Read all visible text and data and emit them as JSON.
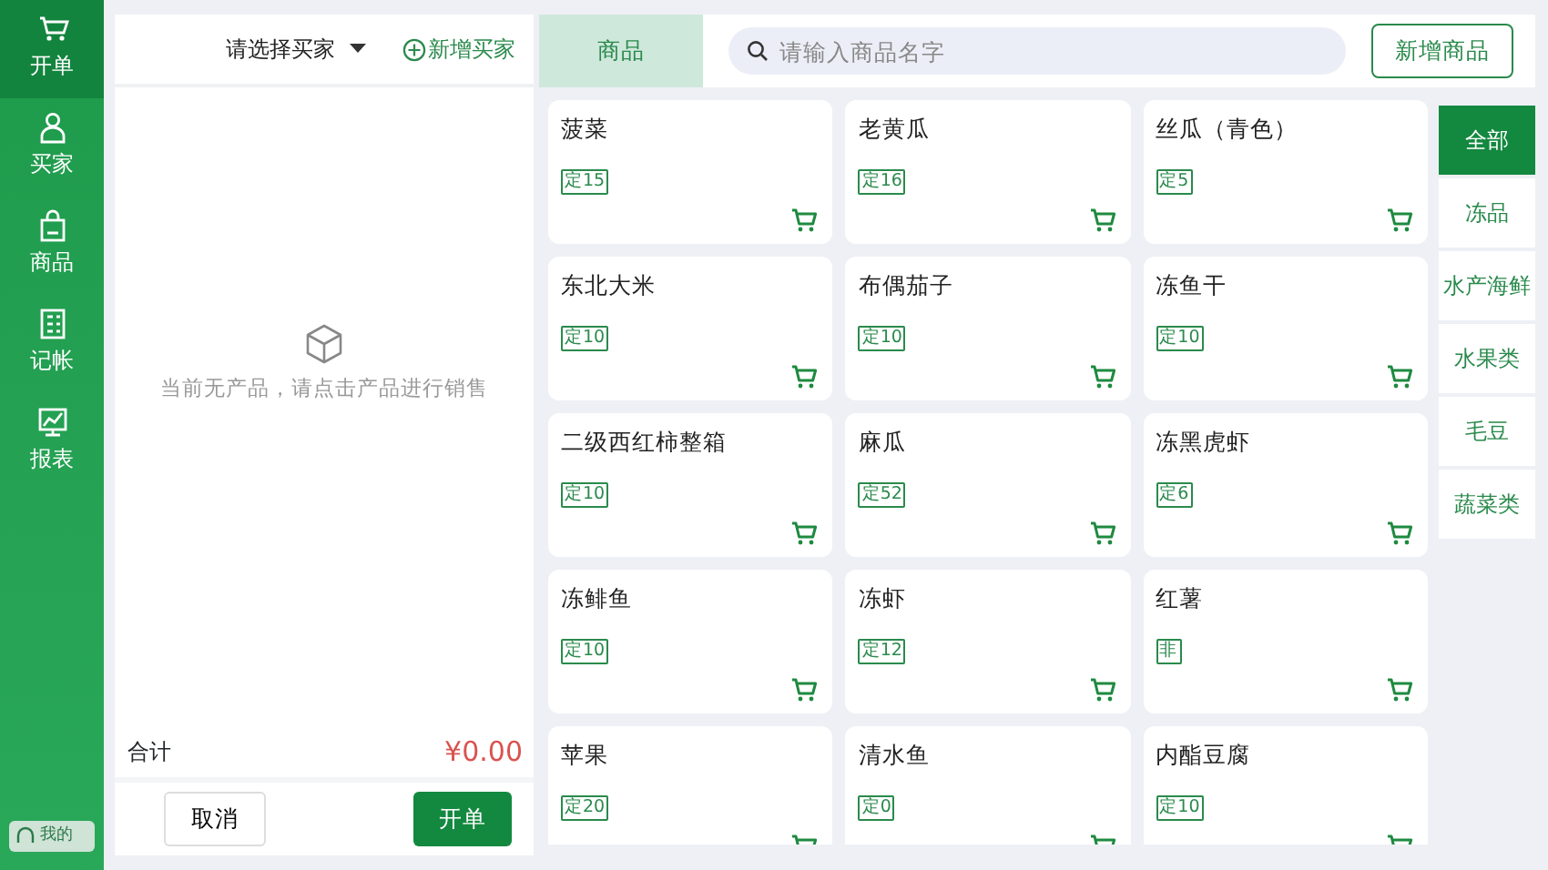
{
  "sidebar": {
    "items": [
      {
        "label": "开单",
        "selected": true
      },
      {
        "label": "买家",
        "selected": false
      },
      {
        "label": "商品",
        "selected": false
      },
      {
        "label": "记帐",
        "selected": false
      },
      {
        "label": "报表",
        "selected": false
      }
    ],
    "profile_button": "我的"
  },
  "order_panel": {
    "buyer_select": "请选择买家",
    "add_buyer": "新增买家",
    "empty_message": "当前无产品，请点击产品进行销售",
    "total_label": "合计",
    "total_value": "¥0.00",
    "cancel_button": "取消",
    "submit_button": "开单"
  },
  "products_tab": "商品",
  "search": {
    "placeholder": "请输入商品名字"
  },
  "add_product_button": "新增商品",
  "products": [
    {
      "name": "菠菜",
      "tag": "定15"
    },
    {
      "name": "老黄瓜",
      "tag": "定16"
    },
    {
      "name": "丝瓜（青色）",
      "tag": "定5"
    },
    {
      "name": "东北大米",
      "tag": "定10"
    },
    {
      "name": "布偶茄子",
      "tag": "定10"
    },
    {
      "name": "冻鱼干",
      "tag": "定10"
    },
    {
      "name": "二级西红柿整箱",
      "tag": "定10"
    },
    {
      "name": "麻瓜",
      "tag": "定52"
    },
    {
      "name": "冻黑虎虾",
      "tag": "定6"
    },
    {
      "name": "冻鲱鱼",
      "tag": "定10"
    },
    {
      "name": "冻虾",
      "tag": "定12"
    },
    {
      "name": "红薯",
      "tag": "非"
    },
    {
      "name": "苹果",
      "tag": "定20"
    },
    {
      "name": "清水鱼",
      "tag": "定0"
    },
    {
      "name": "内酯豆腐",
      "tag": "定10"
    }
  ],
  "categories": [
    {
      "label": "全部",
      "selected": true
    },
    {
      "label": "冻品",
      "selected": false
    },
    {
      "label": "水产海鲜",
      "selected": false
    },
    {
      "label": "水果类",
      "selected": false
    },
    {
      "label": "毛豆",
      "selected": false
    },
    {
      "label": "蔬菜类",
      "selected": false
    }
  ]
}
